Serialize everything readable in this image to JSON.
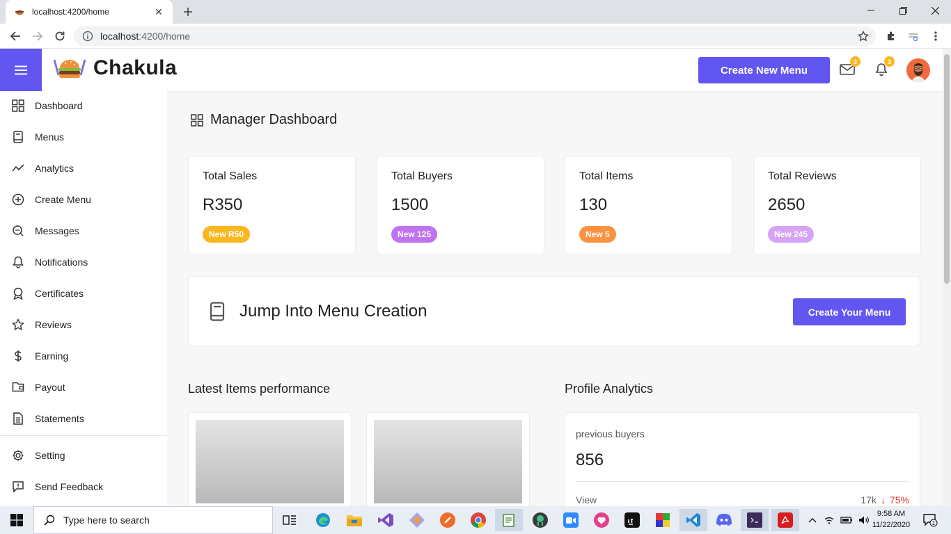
{
  "browser": {
    "tab_title": "localhost:4200/home",
    "url_host": "localhost",
    "url_rest": ":4200/home"
  },
  "header": {
    "brand": "Chakula",
    "create_button": "Create New Menu",
    "mail_badge": "3",
    "notif_badge": "3",
    "accent_color": "#6256f1"
  },
  "sidebar": {
    "items": [
      {
        "label": "Dashboard",
        "icon": "grid-icon"
      },
      {
        "label": "Menus",
        "icon": "book-icon"
      },
      {
        "label": "Analytics",
        "icon": "trend-icon"
      },
      {
        "label": "Create Menu",
        "icon": "plus-circle-icon"
      },
      {
        "label": "Messages",
        "icon": "chat-icon"
      },
      {
        "label": "Notifications",
        "icon": "bell-icon"
      },
      {
        "label": "Certificates",
        "icon": "award-icon"
      },
      {
        "label": "Reviews",
        "icon": "star-icon"
      },
      {
        "label": "Earning",
        "icon": "dollar-icon"
      },
      {
        "label": "Payout",
        "icon": "wallet-icon"
      },
      {
        "label": "Statements",
        "icon": "document-icon"
      }
    ],
    "bottom_items": [
      {
        "label": "Setting",
        "icon": "gear-icon"
      },
      {
        "label": "Send Feedback",
        "icon": "feedback-icon"
      }
    ]
  },
  "main": {
    "title": "Manager Dashboard",
    "stats": [
      {
        "label": "Total Sales",
        "value": "R350",
        "pill": "New R50",
        "pill_color": "#f9b820"
      },
      {
        "label": "Total Buyers",
        "value": "1500",
        "pill": "New 125",
        "pill_color": "#c073f0"
      },
      {
        "label": "Total Items",
        "value": "130",
        "pill": "New 5",
        "pill_color": "#fb9240"
      },
      {
        "label": "Total Reviews",
        "value": "2650",
        "pill": "New 245",
        "pill_color": "#d6a4f5"
      }
    ],
    "jump": {
      "title": "Jump Into Menu Creation",
      "button": "Create Your Menu"
    },
    "latest_title": "Latest Items performance",
    "profile_title": "Profile Analytics",
    "analytics": {
      "caption": "previous buyers",
      "value": "856",
      "row_label": "View",
      "row_value": "17k",
      "row_change": "75%"
    }
  },
  "taskbar": {
    "search_placeholder": "Type here to search",
    "time": "9:58 AM",
    "date": "11/22/2020",
    "notif_count": "1"
  }
}
